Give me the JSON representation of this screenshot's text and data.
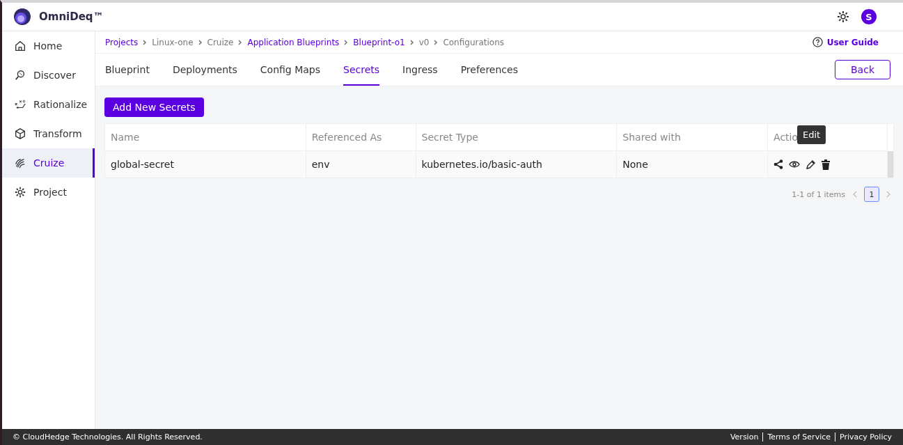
{
  "header": {
    "brand": "OmniDeq™",
    "avatar": "S"
  },
  "sidebar": {
    "items": [
      {
        "label": "Home",
        "selected": false
      },
      {
        "label": "Discover",
        "selected": false
      },
      {
        "label": "Rationalize",
        "selected": false
      },
      {
        "label": "Transform",
        "selected": false
      },
      {
        "label": "Cruize",
        "selected": true
      },
      {
        "label": "Project",
        "selected": false
      }
    ]
  },
  "breadcrumbs": [
    {
      "label": "Projects",
      "link": true
    },
    {
      "label": "Linux-one",
      "link": false
    },
    {
      "label": "Cruize",
      "link": false
    },
    {
      "label": "Application Blueprints",
      "link": true
    },
    {
      "label": "Blueprint-o1",
      "link": true
    },
    {
      "label": "v0",
      "link": false
    },
    {
      "label": "Configurations",
      "link": false
    }
  ],
  "user_guide": "User Guide",
  "tabs": [
    {
      "label": "Blueprint",
      "selected": false
    },
    {
      "label": "Deployments",
      "selected": false
    },
    {
      "label": "Config Maps",
      "selected": false
    },
    {
      "label": "Secrets",
      "selected": true
    },
    {
      "label": "Ingress",
      "selected": false
    },
    {
      "label": "Preferences",
      "selected": false
    }
  ],
  "back_button": "Back",
  "add_button": "Add New Secrets",
  "table": {
    "columns": [
      "Name",
      "Referenced As",
      "Secret Type",
      "Shared with",
      "Actio"
    ],
    "rows": [
      {
        "cells": [
          "global-secret",
          "env",
          "kubernetes.io/basic-auth",
          "None"
        ]
      }
    ]
  },
  "tooltip": "Edit",
  "pagination": {
    "summary": "1-1 of 1 items",
    "pages": [
      {
        "label": "1",
        "selected": true
      }
    ]
  },
  "footer": {
    "copyright": "© CloudHedge Technologies. All Rights Reserved.",
    "links": [
      "Version",
      "Terms of Service",
      "Privacy Policy"
    ]
  }
}
